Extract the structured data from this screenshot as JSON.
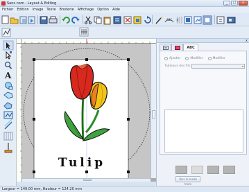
{
  "window": {
    "title": "Sans nom - Layout & Editing",
    "controls": [
      "minimize",
      "maximize",
      "close"
    ]
  },
  "menu": [
    "Fichier",
    "Edition",
    "Image",
    "Texte",
    "Broderie",
    "Affichage",
    "Option",
    "Aide"
  ],
  "toolbar_icons": [
    "new-icon",
    "open-icon",
    "open-template-icon",
    "import-icon",
    "save-icon",
    "print-icon",
    "undo-icon",
    "redo-icon",
    "cut-icon",
    "copy-icon",
    "paste-icon",
    "duplicate-icon",
    "delete-icon",
    "group-icon",
    "rotate-icon",
    "magic-wand-icon",
    "text-arc-icon",
    "text-vertical-icon",
    "layout-icon",
    "sewing-preview-icon",
    "design-settings-icon",
    "transfer-icon",
    "card-writer-icon"
  ],
  "tools": [
    "select-icon",
    "point-edit-icon",
    "zoom-icon",
    "text-icon",
    "shape-icon",
    "outline-icon",
    "fill-icon",
    "stitch-icon",
    "line-icon",
    "grid-icon",
    "stitch-direction-icon"
  ],
  "design": {
    "text": "Tulip"
  },
  "panel": {
    "tab_label": "ABC",
    "radios": [
      "Ajouter",
      "Modifier",
      "Modifier"
    ],
    "font_label": "Tableaux des fils",
    "convert_button": "Vers le mode texte"
  },
  "status": {
    "text": "Largeur = 149.00 mm, Hauteur = 124.20 mm"
  },
  "colors": {
    "tulip_red": "#d8291f",
    "tulip_orange": "#ee7f1f",
    "tulip_yellow": "#f2c418",
    "leaf_green": "#3ea33e",
    "canvas_gray": "#c6c6c6"
  }
}
